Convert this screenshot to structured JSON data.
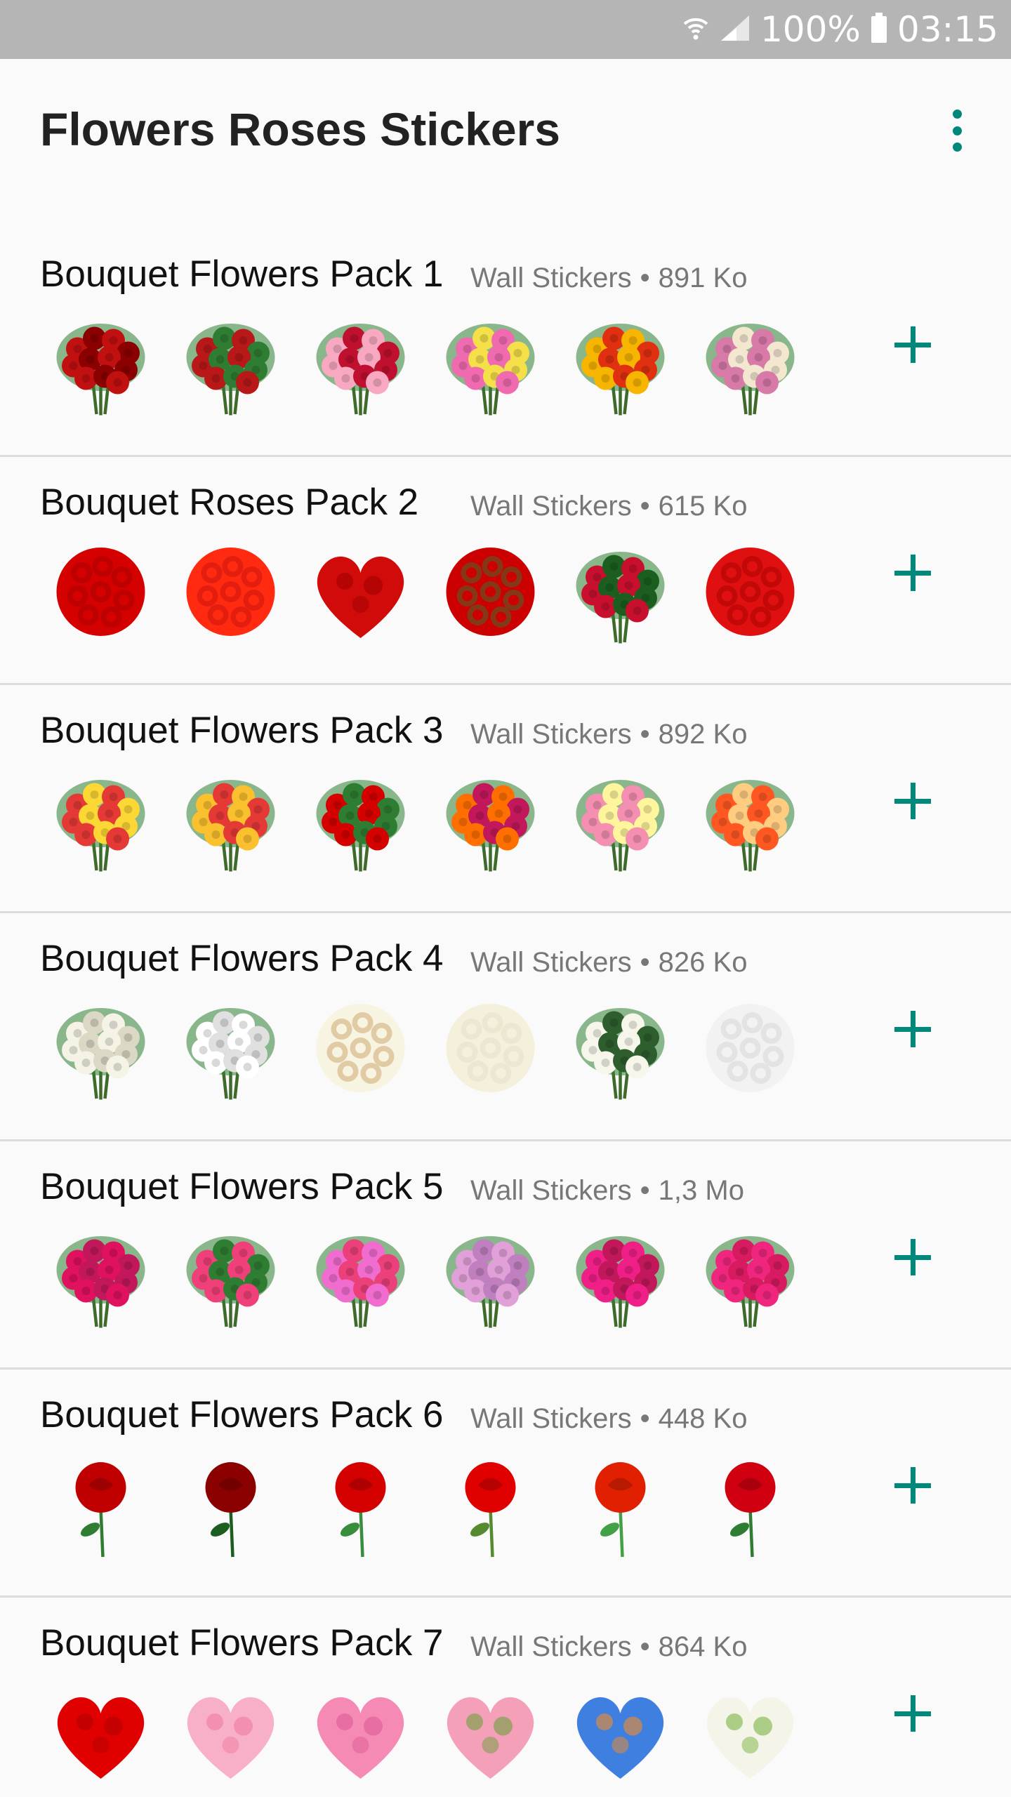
{
  "status_bar": {
    "battery": "100%",
    "time": "03:15"
  },
  "app": {
    "title": "Flowers Roses Stickers",
    "accent": "#00897b"
  },
  "packs": [
    {
      "name": "Bouquet Flowers Pack 1",
      "publisher": "Wall Stickers",
      "size": "891 Ko",
      "stickers": [
        {
          "shape": "bouquet",
          "colors": [
            "#c01010",
            "#8b0000"
          ]
        },
        {
          "shape": "bouquet",
          "colors": [
            "#b81818",
            "#2e7d32"
          ]
        },
        {
          "shape": "bouquet",
          "colors": [
            "#f8a8c0",
            "#c01030"
          ]
        },
        {
          "shape": "bouquet",
          "colors": [
            "#f06ab0",
            "#f5e04a"
          ]
        },
        {
          "shape": "bouquet",
          "colors": [
            "#f7b500",
            "#e03010"
          ]
        },
        {
          "shape": "bouquet",
          "colors": [
            "#d87aa8",
            "#f3e7d0"
          ]
        }
      ]
    },
    {
      "name": "Bouquet Roses Pack 2",
      "publisher": "Wall Stickers",
      "size": "615 Ko",
      "stickers": [
        {
          "shape": "round",
          "colors": [
            "#d50000",
            "#a00000"
          ]
        },
        {
          "shape": "round",
          "colors": [
            "#ff2a10",
            "#c01010"
          ]
        },
        {
          "shape": "heart",
          "colors": [
            "#d10a0a",
            "#a00000"
          ]
        },
        {
          "shape": "round",
          "colors": [
            "#cc0000",
            "#2e7d32"
          ]
        },
        {
          "shape": "bouquet",
          "colors": [
            "#c8102e",
            "#1b5e20"
          ]
        },
        {
          "shape": "round",
          "colors": [
            "#e01010",
            "#a00000"
          ]
        }
      ]
    },
    {
      "name": "Bouquet Flowers Pack 3",
      "publisher": "Wall Stickers",
      "size": "892 Ko",
      "stickers": [
        {
          "shape": "bouquet",
          "colors": [
            "#e53935",
            "#fdd835"
          ]
        },
        {
          "shape": "bouquet",
          "colors": [
            "#fbc02d",
            "#e53935"
          ]
        },
        {
          "shape": "bouquet",
          "colors": [
            "#d50000",
            "#2e7d32"
          ]
        },
        {
          "shape": "bouquet",
          "colors": [
            "#ff6f00",
            "#c2185b"
          ]
        },
        {
          "shape": "bouquet",
          "colors": [
            "#f48fb1",
            "#fff59d"
          ]
        },
        {
          "shape": "bouquet",
          "colors": [
            "#ff5722",
            "#ffcc80"
          ]
        }
      ]
    },
    {
      "name": "Bouquet Flowers Pack 4",
      "publisher": "Wall Stickers",
      "size": "826 Ko",
      "stickers": [
        {
          "shape": "bouquet",
          "colors": [
            "#f5f2e6",
            "#dcd8c6"
          ]
        },
        {
          "shape": "bouquet",
          "colors": [
            "#ffffff",
            "#e0e0e0"
          ]
        },
        {
          "shape": "round",
          "colors": [
            "#f8f4e2",
            "#c49a5a"
          ]
        },
        {
          "shape": "round",
          "colors": [
            "#f5f0dc",
            "#e3dcc0"
          ]
        },
        {
          "shape": "bouquet",
          "colors": [
            "#f6f6ea",
            "#2e5d2e"
          ]
        },
        {
          "shape": "round",
          "colors": [
            "#f2f2f2",
            "#d0d0d0"
          ]
        }
      ]
    },
    {
      "name": "Bouquet Flowers Pack 5",
      "publisher": "Wall Stickers",
      "size": "1,3 Mo",
      "stickers": [
        {
          "shape": "bouquet",
          "colors": [
            "#e0115f",
            "#c2185b"
          ]
        },
        {
          "shape": "bouquet",
          "colors": [
            "#f0407a",
            "#2e7d32"
          ]
        },
        {
          "shape": "bouquet",
          "colors": [
            "#f06ccf",
            "#ec407a"
          ]
        },
        {
          "shape": "bouquet",
          "colors": [
            "#e2a0d8",
            "#c080c0"
          ]
        },
        {
          "shape": "bouquet",
          "colors": [
            "#f01f87",
            "#c2185b"
          ]
        },
        {
          "shape": "bouquet",
          "colors": [
            "#f0267e",
            "#d81b60"
          ]
        }
      ]
    },
    {
      "name": "Bouquet Flowers Pack 6",
      "publisher": "Wall Stickers",
      "size": "448 Ko",
      "stickers": [
        {
          "shape": "rose",
          "colors": [
            "#c00000",
            "#2e7d32"
          ]
        },
        {
          "shape": "rose",
          "colors": [
            "#8b0000",
            "#1b5e20"
          ]
        },
        {
          "shape": "rose",
          "colors": [
            "#d50000",
            "#388e3c"
          ]
        },
        {
          "shape": "rose",
          "colors": [
            "#e00000",
            "#558b2f"
          ]
        },
        {
          "shape": "rose",
          "colors": [
            "#e02000",
            "#43a047"
          ]
        },
        {
          "shape": "rose",
          "colors": [
            "#d00010",
            "#2e7d32"
          ]
        }
      ]
    },
    {
      "name": "Bouquet Flowers Pack 7",
      "publisher": "Wall Stickers",
      "size": "864 Ko",
      "stickers": [
        {
          "shape": "heart",
          "colors": [
            "#e00000",
            "#b00000"
          ]
        },
        {
          "shape": "heart",
          "colors": [
            "#f8b0c8",
            "#f07aa0"
          ]
        },
        {
          "shape": "heart",
          "colors": [
            "#f58ab4",
            "#e05b95"
          ]
        },
        {
          "shape": "heart",
          "colors": [
            "#f4a0b8",
            "#6d9e3e"
          ]
        },
        {
          "shape": "heart",
          "colors": [
            "#3f7fe0",
            "#f28c28"
          ]
        },
        {
          "shape": "heart",
          "colors": [
            "#f4f4e8",
            "#7cb342"
          ]
        }
      ]
    }
  ]
}
